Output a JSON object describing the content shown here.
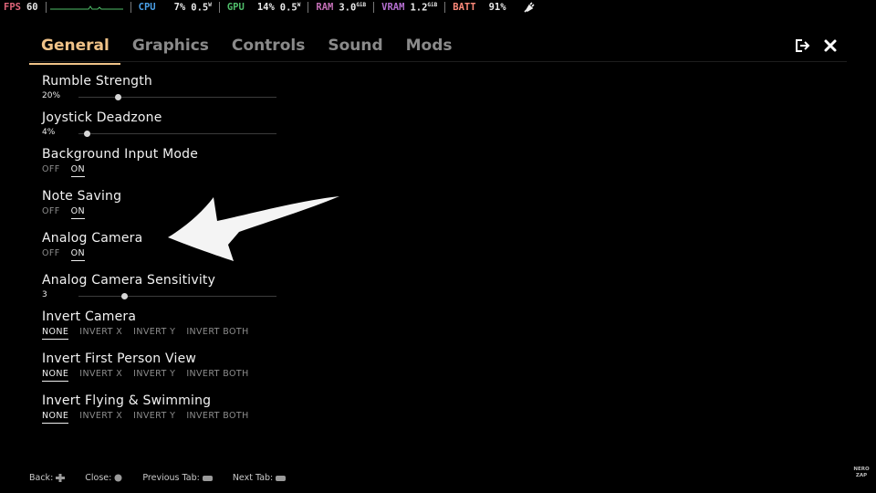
{
  "overlay": {
    "fps_label": "FPS",
    "fps_value": "60",
    "cpu_label": "CPU",
    "cpu_usage": "7%",
    "cpu_power": "0.5",
    "cpu_power_unit": "W",
    "gpu_label": "GPU",
    "gpu_usage": "14%",
    "gpu_power": "0.5",
    "gpu_power_unit": "W",
    "ram_label": "RAM",
    "ram_value": "3.0",
    "ram_unit": "GiB",
    "vram_label": "VRAM",
    "vram_value": "1.2",
    "vram_unit": "GiB",
    "batt_label": "BATT",
    "batt_value": "91%",
    "colors": {
      "fps": "#e0657a",
      "cpu": "#4aa0e8",
      "gpu": "#4fbf6a",
      "ram": "#c46fb6",
      "vram": "#b46fd0",
      "batt": "#ff8a7a"
    }
  },
  "tabs": [
    {
      "label": "General",
      "active": true
    },
    {
      "label": "Graphics",
      "active": false
    },
    {
      "label": "Controls",
      "active": false
    },
    {
      "label": "Sound",
      "active": false
    },
    {
      "label": "Mods",
      "active": false
    }
  ],
  "accent_color": "#efc288",
  "settings": {
    "rumble": {
      "title": "Rumble Strength",
      "value": "20%",
      "fraction": 0.2
    },
    "deadzone": {
      "title": "Joystick Deadzone",
      "value": "4%",
      "fraction": 0.04
    },
    "background_input": {
      "title": "Background Input Mode",
      "options": [
        "OFF",
        "ON"
      ],
      "selected": "ON"
    },
    "note_saving": {
      "title": "Note Saving",
      "options": [
        "OFF",
        "ON"
      ],
      "selected": "ON"
    },
    "analog_camera": {
      "title": "Analog Camera",
      "options": [
        "OFF",
        "ON"
      ],
      "selected": "ON"
    },
    "analog_sensitivity": {
      "title": "Analog Camera Sensitivity",
      "value": "3",
      "fraction": 0.23
    },
    "invert_camera": {
      "title": "Invert Camera",
      "options": [
        "NONE",
        "INVERT X",
        "INVERT Y",
        "INVERT BOTH"
      ],
      "selected": "NONE"
    },
    "invert_fpv": {
      "title": "Invert First Person View",
      "options": [
        "NONE",
        "INVERT X",
        "INVERT Y",
        "INVERT BOTH"
      ],
      "selected": "NONE"
    },
    "invert_flying": {
      "title": "Invert Flying & Swimming",
      "options": [
        "NONE",
        "INVERT X",
        "INVERT Y",
        "INVERT BOTH"
      ],
      "selected": "NONE"
    }
  },
  "footer": {
    "back": "Back:",
    "back_icon": "dpad-icon",
    "close": "Close:",
    "close_icon": "b-button-icon",
    "prev_tab": "Previous Tab:",
    "prev_icon": "shoulder-button-icon",
    "next_tab": "Next Tab:",
    "next_icon": "shoulder-button-icon"
  },
  "watermark": {
    "line1": "NERO",
    "line2": "ZAP"
  },
  "icons": {
    "exit": "exit-icon",
    "close": "close-icon",
    "power": "plug-icon",
    "annotation": "arrow-icon"
  }
}
